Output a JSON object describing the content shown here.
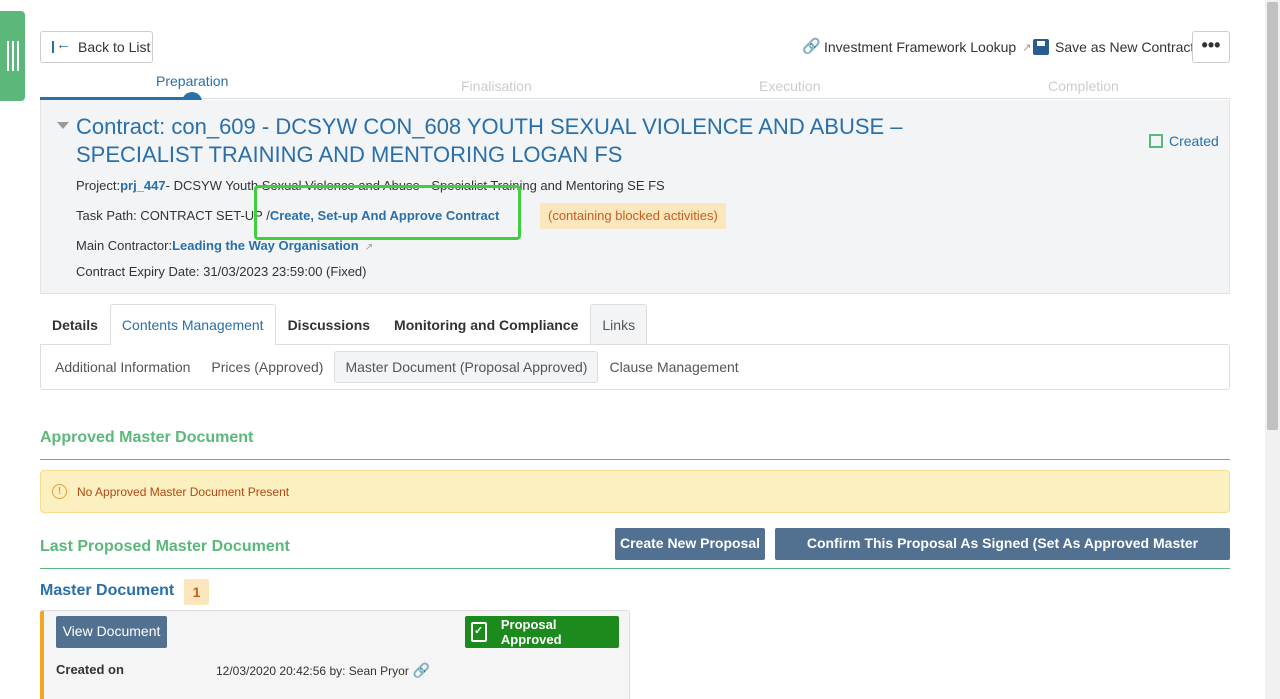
{
  "toolbar": {
    "back_label": "Back to List",
    "investment_lookup_label": "Investment Framework Lookup",
    "save_new_label": "Save as New Contract",
    "more_label": "•••"
  },
  "stepper": {
    "steps": [
      {
        "label": "Preparation",
        "state": "active"
      },
      {
        "label": "Finalisation",
        "state": "inactive"
      },
      {
        "label": "Execution",
        "state": "inactive"
      },
      {
        "label": "Completion",
        "state": "inactive"
      }
    ]
  },
  "contract": {
    "title": "Contract: con_609 - DCSYW CON_608 YOUTH SEXUAL VIOLENCE AND ABUSE – SPECIALIST TRAINING AND MENTORING LOGAN FS",
    "status": "Created",
    "project_label": "Project:",
    "project_link": "prj_447",
    "project_text": "- DCSYW Youth Sexual Violence and Abuse - Specialist Training and Mentoring SE FS",
    "task_path_label": "Task Path: CONTRACT SET-UP /",
    "task_path_link": "Create, Set-up And Approve Contract",
    "blocked_note": "(containing blocked activities)",
    "main_contractor_label": "Main Contractor:",
    "main_contractor_link": "Leading the Way Organisation",
    "expiry_label": "Contract Expiry Date: 31/03/2023 23:59:00 (Fixed)"
  },
  "tabs": [
    {
      "label": "Details"
    },
    {
      "label": "Contents Management"
    },
    {
      "label": "Discussions"
    },
    {
      "label": "Monitoring and Compliance"
    },
    {
      "label": "Links"
    }
  ],
  "subtabs": [
    {
      "label": "Additional Information"
    },
    {
      "label": "Prices (Approved)"
    },
    {
      "label": "Master Document (Proposal Approved)"
    },
    {
      "label": "Clause Management"
    }
  ],
  "approved_section": {
    "title": "Approved Master Document",
    "alert_icon": "!",
    "alert_text": "No Approved Master Document Present"
  },
  "proposed_section": {
    "title": "Last Proposed Master Document",
    "create_label": "Create New Proposal",
    "confirm_label": "Confirm This Proposal As Signed (Set As Approved Master Document)"
  },
  "master_document": {
    "title": "Master Document",
    "count": "1",
    "view_label": "View Document",
    "status_label": "Proposal Approved",
    "created_label": "Created on",
    "created_value": "12/03/2020 20:42:56 by: Sean Pryor"
  },
  "colors": {
    "accent_blue": "#2a6fa8",
    "section_green": "#5cb87a",
    "button_slate": "#52708f",
    "approved_green": "#1d8a1d",
    "warning_bg": "#fcefc0"
  }
}
